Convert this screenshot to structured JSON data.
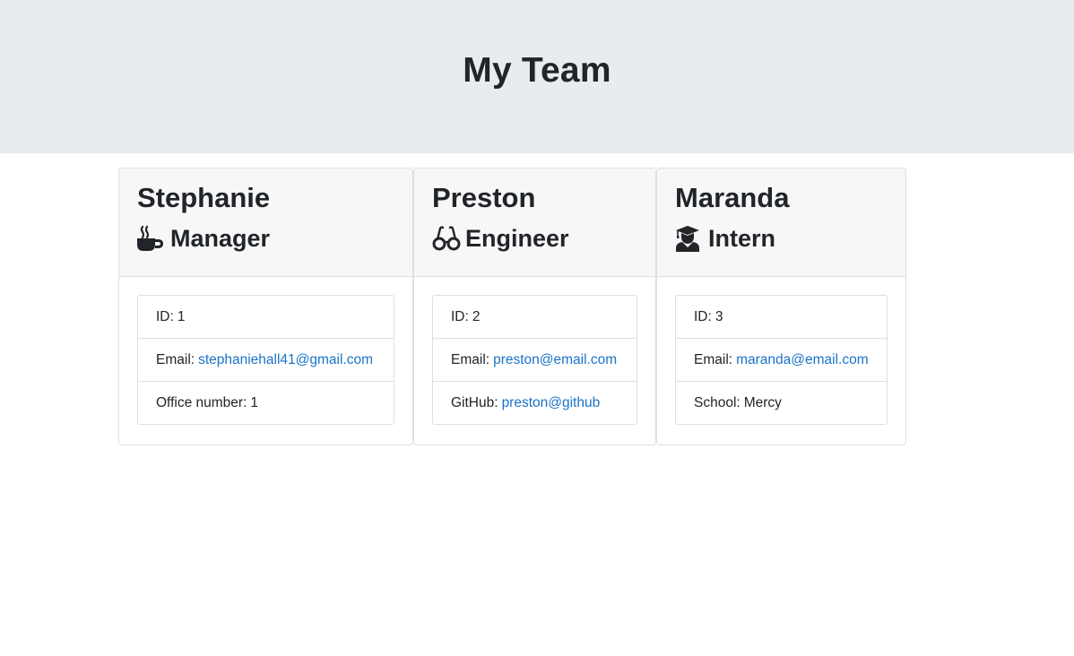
{
  "header": {
    "title": "My Team"
  },
  "colors": {
    "jumbotron_bg": "#e9ecef",
    "link": "#1a73c7",
    "text": "#212529"
  },
  "employees": [
    {
      "name": "Stephanie",
      "role": "Manager",
      "icon": "coffee-icon",
      "id_label": "ID:",
      "id_value": "1",
      "email_label": "Email:",
      "email": "stephaniehall41@gmail.com",
      "extra_label": "Office number:",
      "extra_value": "1"
    },
    {
      "name": "Preston",
      "role": "Engineer",
      "icon": "glasses-icon",
      "id_label": "ID:",
      "id_value": "2",
      "email_label": "Email:",
      "email": "preston@email.com",
      "extra_label": "GitHub:",
      "extra_value": "preston@github"
    },
    {
      "name": "Maranda",
      "role": "Intern",
      "icon": "graduate-icon",
      "id_label": "ID:",
      "id_value": "3",
      "email_label": "Email:",
      "email": "maranda@email.com",
      "extra_label": "School:",
      "extra_value": "Mercy"
    }
  ]
}
